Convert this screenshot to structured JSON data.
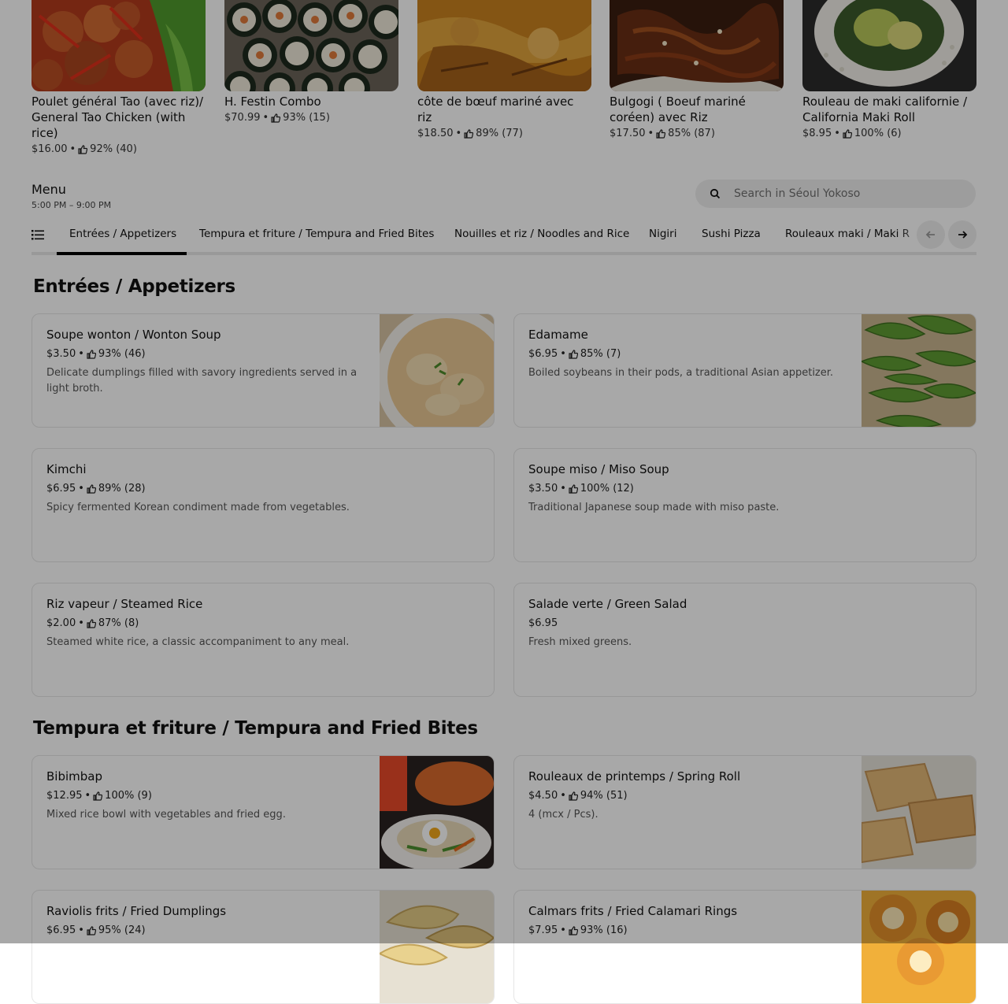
{
  "featured": [
    {
      "name": "Poulet général Tao (avec riz)/ General Tao Chicken (with rice)",
      "price": "$16.00",
      "rating": "92% (40)"
    },
    {
      "name": "H. Festin Combo",
      "price": "$70.99",
      "rating": "93% (15)"
    },
    {
      "name": "côte de bœuf mariné avec riz",
      "price": "$18.50",
      "rating": "89% (77)"
    },
    {
      "name": "Bulgogi ( Boeuf mariné coréen) avec Riz",
      "price": "$17.50",
      "rating": "85% (87)"
    },
    {
      "name": "Rouleau de maki californie / California Maki Roll",
      "price": "$8.95",
      "rating": "100% (6)"
    }
  ],
  "menu": {
    "title": "Menu",
    "hours": "5:00 PM – 9:00 PM",
    "search_placeholder": "Search in Séoul Yokoso"
  },
  "tabs": [
    "Entrées / Appetizers",
    "Tempura et friture / Tempura and Fried Bites",
    "Nouilles et riz / Noodles and Rice",
    "Nigiri",
    "Sushi Pizza",
    "Rouleaux maki / Maki R"
  ],
  "sections": [
    {
      "title": "Entrées / Appetizers",
      "items": [
        {
          "name": "Soupe wonton / Wonton Soup",
          "price": "$3.50",
          "rating": "93% (46)",
          "desc": "Delicate dumplings filled with savory ingredients served in a light broth."
        },
        {
          "name": "Edamame",
          "price": "$6.95",
          "rating": "85% (7)",
          "desc": "Boiled soybeans in their pods, a traditional Asian appetizer."
        },
        {
          "name": "Kimchi",
          "price": "$6.95",
          "rating": "89% (28)",
          "desc": "Spicy fermented Korean condiment made from vegetables."
        },
        {
          "name": "Soupe miso / Miso Soup",
          "price": "$3.50",
          "rating": "100% (12)",
          "desc": "Traditional Japanese soup made with miso paste."
        },
        {
          "name": "Riz vapeur / Steamed Rice",
          "price": "$2.00",
          "rating": "87% (8)",
          "desc": "Steamed white rice, a classic accompaniment to any meal."
        },
        {
          "name": "Salade verte / Green Salad",
          "price": "$6.95",
          "rating": "",
          "desc": "Fresh mixed greens."
        }
      ]
    },
    {
      "title": "Tempura et friture / Tempura and Fried Bites",
      "items": [
        {
          "name": "Bibimbap",
          "price": "$12.95",
          "rating": "100% (9)",
          "desc": "Mixed rice bowl with vegetables and fried egg."
        },
        {
          "name": "Rouleaux de printemps / Spring Roll",
          "price": "$4.50",
          "rating": "94% (51)",
          "desc": "4 (mcx / Pcs)."
        },
        {
          "name": "Raviolis frits / Fried Dumplings",
          "price": "$6.95",
          "rating": "95% (24)",
          "desc": ""
        },
        {
          "name": "Calmars frits / Fried Calamari Rings",
          "price": "$7.95",
          "rating": "93% (16)",
          "desc": ""
        }
      ]
    }
  ],
  "sep": "•"
}
